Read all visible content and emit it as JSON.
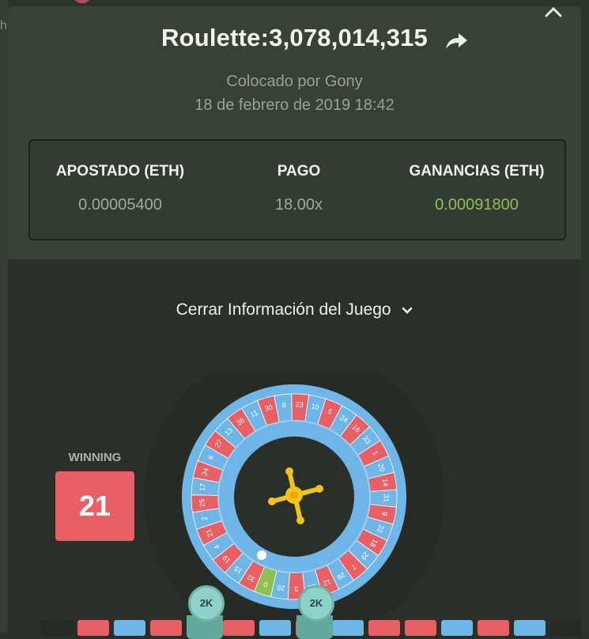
{
  "background": {
    "partial_letter": "h"
  },
  "modal": {
    "title": "Roulette:3,078,014,315",
    "placed_by": "Colocado por Gony",
    "date": "18 de febrero de 2019 18:42",
    "close_icon": "close-icon",
    "share_icon": "share-icon"
  },
  "stats": {
    "wager": {
      "label": "APOSTADO (ETH)",
      "value": "0.00005400"
    },
    "payout": {
      "label": "PAGO",
      "value": "18.00x"
    },
    "profit": {
      "label": "GANANCIAS (ETH)",
      "value": "0.00091800"
    }
  },
  "toggle": {
    "label": "Cerrar Información del Juego"
  },
  "result": {
    "label": "WINNING",
    "number": "21"
  },
  "wheel": {
    "numbers": [
      "0",
      "32",
      "15",
      "19",
      "4",
      "21",
      "2",
      "25",
      "17",
      "34",
      "6",
      "27",
      "13",
      "36",
      "11",
      "30",
      "8",
      "23",
      "10",
      "5",
      "24",
      "16",
      "33",
      "1",
      "20",
      "14",
      "31",
      "9",
      "22",
      "18",
      "29",
      "7",
      "28",
      "12",
      "35",
      "3",
      "26"
    ],
    "ball_number": "21"
  },
  "chips": [
    {
      "label": "2K"
    },
    {
      "label": "2K"
    }
  ],
  "colors": {
    "red": "#e85f64",
    "blue": "#6eb6e8",
    "green": "#8fbf4e",
    "chip": "#8fd0c8"
  }
}
